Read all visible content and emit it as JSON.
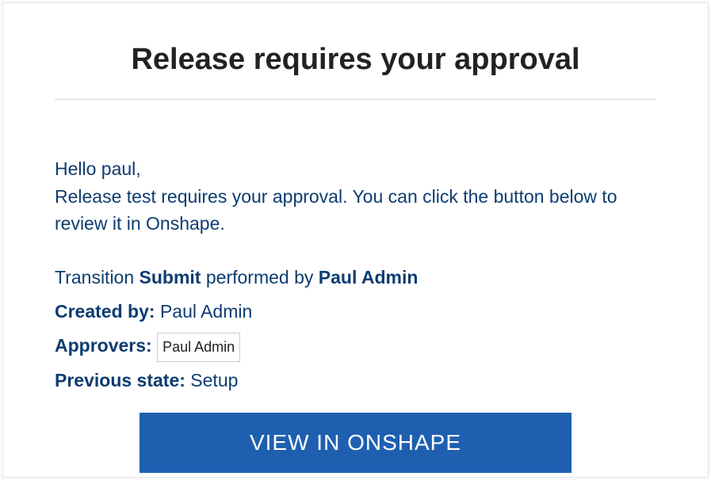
{
  "title": "Release requires your approval",
  "greeting": "Hello paul,",
  "message": "Release test requires your approval. You can click the button below to review it in Onshape.",
  "transition": {
    "prefix": "Transition ",
    "action": "Submit",
    "middle": " performed by ",
    "actor": "Paul Admin"
  },
  "created_by": {
    "label": "Created by: ",
    "value": "Paul Admin"
  },
  "approvers": {
    "label": "Approvers: ",
    "chip": "Paul Admin"
  },
  "previous_state": {
    "label": "Previous state: ",
    "value": "Setup"
  },
  "cta": "VIEW IN ONSHAPE"
}
